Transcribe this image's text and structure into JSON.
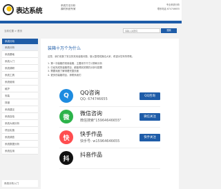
{
  "header": {
    "logo_text": "表达系统",
    "slogan_line1": "系统方法分析",
    "slogan_line2": "鼎时系统专家",
    "contact_line1": "专业系统分析",
    "contact_line2": "联系电话 674746655"
  },
  "breadcrumb": "当前位置 > 首页",
  "search": {
    "placeholder": "请输入关键词",
    "button": "搜索"
  },
  "sidebar": {
    "heading": "系统分析",
    "items": [
      "系统分析",
      "系统基础",
      "系统入门",
      "系统调研",
      "系统工具",
      "系统使用",
      "维护",
      "安装",
      "排错",
      "系统建议",
      "系统自检",
      "系统大纲分析",
      "项目实施",
      "系统调查",
      "系统数据分析",
      "系统应用"
    ],
    "bottom_link": "系统分析入门"
  },
  "main": {
    "title": "装箱十万个为什么",
    "intro": "这是，我们收集了常见的常用装箱问题，做以整理成篇给大家，希望对您有所帮助。",
    "tips": [
      "1. 第一次装箱的常用装箱，主要用于尺寸计算和分析",
      "2. 已经完成的装箱项目，都能得到关联的分析与配置",
      "3. 需要深度了解请看完整页面",
      "4. 更多的装箱项目，请联系我们"
    ]
  },
  "cards": [
    {
      "icon": "Q",
      "icon_color": "#1e8ce0",
      "name": "QQ咨询",
      "sub": "QQ: 674746655",
      "button": "QQ咨询"
    },
    {
      "icon": "微",
      "icon_color": "#2cb34a",
      "name": "微信咨询",
      "sub": "微信搜索\"15964646655\"",
      "button": "微信关注"
    },
    {
      "icon": "快",
      "icon_color": "#ff4d4f",
      "name": "快手作品",
      "sub": "快手号: w15964646655",
      "button": "快手关注"
    },
    {
      "icon": "抖",
      "icon_color": "#111111",
      "name": "抖音作品",
      "sub": "",
      "button": ""
    }
  ]
}
